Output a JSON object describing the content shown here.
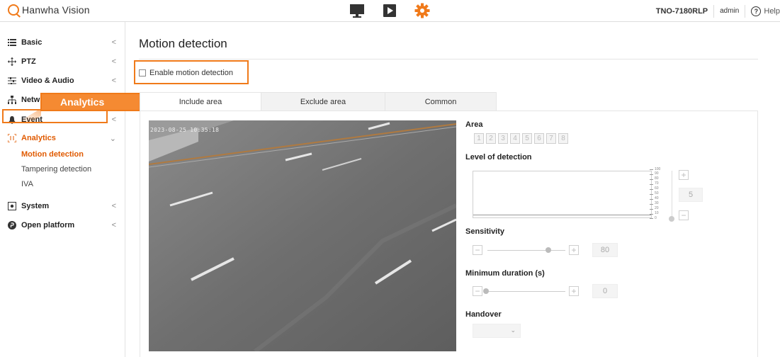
{
  "header": {
    "logo_text": "Hanwha Vision",
    "model": "TNO-7180RLP",
    "user": "admin",
    "help_label": "Help",
    "help_glyph": "?",
    "icons": [
      "monitor-icon",
      "playback-icon",
      "settings-gear-icon"
    ],
    "accent_color": "#f07a1a"
  },
  "sidebar": {
    "items": [
      {
        "label": "Basic",
        "icon": "list-icon",
        "chevron": "<"
      },
      {
        "label": "PTZ",
        "icon": "move-arrows-icon",
        "chevron": "<"
      },
      {
        "label": "Video & Audio",
        "icon": "sliders-icon",
        "chevron": "<"
      },
      {
        "label": "Netw",
        "icon": "network-icon",
        "chevron": "<"
      },
      {
        "label": "Event",
        "icon": "bell-icon",
        "chevron": "<"
      },
      {
        "label": "Analytics",
        "icon": "analytics-frame-icon",
        "chevron": "⌄"
      },
      {
        "label": "System",
        "icon": "system-icon",
        "chevron": "<"
      },
      {
        "label": "Open platform",
        "icon": "open-platform-icon",
        "chevron": "<"
      }
    ],
    "analytics_sub": [
      "Motion detection",
      "Tampering detection",
      "IVA"
    ],
    "active_color": "#e05a00"
  },
  "callout": {
    "label": "Analytics"
  },
  "main": {
    "title": "Motion detection",
    "enable_label": "Enable motion detection",
    "enable_checked": false,
    "tabs": [
      "Include area",
      "Exclude area",
      "Common"
    ],
    "active_tab": "Include area",
    "video_timestamp": "2023-08-25 10:35:18"
  },
  "settings": {
    "area_label": "Area",
    "areas": [
      "1",
      "2",
      "3",
      "4",
      "5",
      "6",
      "7",
      "8"
    ],
    "level_label": "Level of detection",
    "level_scale": [
      "100",
      "90",
      "80",
      "70",
      "60",
      "50",
      "40",
      "30",
      "20",
      "10",
      "0"
    ],
    "level_value": "5",
    "sensitivity_label": "Sensitivity",
    "sensitivity_value": "80",
    "min_duration_label": "Minimum duration (s)",
    "min_duration_value": "0",
    "handover_label": "Handover",
    "handover_value": "",
    "minus": "−",
    "plus": "+"
  }
}
